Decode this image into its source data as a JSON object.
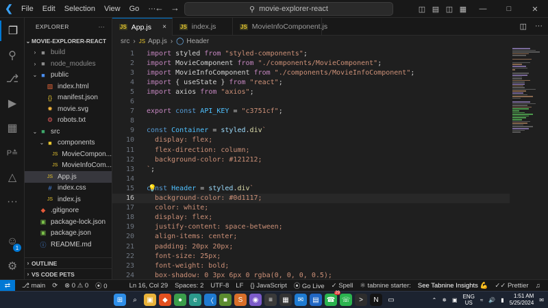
{
  "titlebar": {
    "menu": [
      "File",
      "Edit",
      "Selection",
      "View",
      "Go",
      "···"
    ],
    "search": "movie-explorer-react"
  },
  "activity": {
    "icons": [
      "explorer-icon",
      "search-icon",
      "source-control-icon",
      "run-debug-icon",
      "extensions-icon",
      "testing-icon",
      "remote-explorer-icon",
      "more-icon",
      "accounts-icon",
      "settings-icon"
    ],
    "accounts_badge": "1"
  },
  "sidebar": {
    "header": "EXPLORER",
    "header_more": "···",
    "root": "MOVIE-EXPLORER-REACT",
    "tree": [
      {
        "label": "build",
        "depth": 1,
        "type": "folder",
        "open": false,
        "dim": true
      },
      {
        "label": "node_modules",
        "depth": 1,
        "type": "folder",
        "open": false,
        "dim": true
      },
      {
        "label": "public",
        "depth": 1,
        "type": "folder-public",
        "open": true
      },
      {
        "label": "index.html",
        "depth": 2,
        "type": "html"
      },
      {
        "label": "manifest.json",
        "depth": 2,
        "type": "json"
      },
      {
        "label": "movie.svg",
        "depth": 2,
        "type": "svg"
      },
      {
        "label": "robots.txt",
        "depth": 2,
        "type": "txt"
      },
      {
        "label": "src",
        "depth": 1,
        "type": "folder-src",
        "open": true
      },
      {
        "label": "components",
        "depth": 2,
        "type": "folder-comp",
        "open": true
      },
      {
        "label": "MovieCompon...",
        "depth": 3,
        "type": "js"
      },
      {
        "label": "MovieInfoCom...",
        "depth": 3,
        "type": "js"
      },
      {
        "label": "App.js",
        "depth": 2,
        "type": "js",
        "selected": true
      },
      {
        "label": "index.css",
        "depth": 2,
        "type": "css"
      },
      {
        "label": "index.js",
        "depth": 2,
        "type": "js"
      },
      {
        "label": ".gitignore",
        "depth": 1,
        "type": "git"
      },
      {
        "label": "package-lock.json",
        "depth": 1,
        "type": "npm"
      },
      {
        "label": "package.json",
        "depth": 1,
        "type": "npm"
      },
      {
        "label": "README.md",
        "depth": 1,
        "type": "info"
      }
    ],
    "outline": "OUTLINE",
    "pets": "VS CODE PETS"
  },
  "tabs": [
    {
      "label": "App.js",
      "active": true,
      "close": "×"
    },
    {
      "label": "index.js",
      "active": false
    },
    {
      "label": "MovieInfoComponent.js",
      "active": false
    }
  ],
  "breadcrumb": {
    "folder": "src",
    "file": "App.js",
    "symbol": "Header"
  },
  "editor": {
    "current_line": 16,
    "lines": [
      [
        [
          "kw2",
          "import"
        ],
        [
          "txt",
          " styled "
        ],
        [
          "kw2",
          "from"
        ],
        [
          "txt",
          " "
        ],
        [
          "str",
          "\"styled-components\""
        ],
        [
          "txt",
          ";"
        ]
      ],
      [
        [
          "kw2",
          "import"
        ],
        [
          "txt",
          " MovieComponent "
        ],
        [
          "kw2",
          "from"
        ],
        [
          "txt",
          " "
        ],
        [
          "str",
          "\"./components/MovieComponent\""
        ],
        [
          "txt",
          ";"
        ]
      ],
      [
        [
          "kw2",
          "import"
        ],
        [
          "txt",
          " MovieInfoComponent "
        ],
        [
          "kw2",
          "from"
        ],
        [
          "txt",
          " "
        ],
        [
          "str",
          "\"./components/MovieInfoComponent\""
        ],
        [
          "txt",
          ";"
        ]
      ],
      [
        [
          "kw2",
          "import"
        ],
        [
          "txt",
          " { useState } "
        ],
        [
          "kw2",
          "from"
        ],
        [
          "txt",
          " "
        ],
        [
          "str",
          "\"react\""
        ],
        [
          "txt",
          ";"
        ]
      ],
      [
        [
          "kw2",
          "import"
        ],
        [
          "txt",
          " axios "
        ],
        [
          "kw2",
          "from"
        ],
        [
          "txt",
          " "
        ],
        [
          "str",
          "\"axios\""
        ],
        [
          "txt",
          ";"
        ]
      ],
      [],
      [
        [
          "kw2",
          "export"
        ],
        [
          "txt",
          " "
        ],
        [
          "kw",
          "const"
        ],
        [
          "txt",
          " "
        ],
        [
          "const",
          "API_KEY"
        ],
        [
          "txt",
          " = "
        ],
        [
          "str",
          "\"c3751cf\""
        ],
        [
          "txt",
          ";"
        ]
      ],
      [],
      [
        [
          "kw",
          "const"
        ],
        [
          "txt",
          " "
        ],
        [
          "const",
          "Container"
        ],
        [
          "txt",
          " = "
        ],
        [
          "var",
          "styled"
        ],
        [
          "txt",
          "."
        ],
        [
          "fn",
          "div"
        ],
        [
          "str",
          "`"
        ]
      ],
      [
        [
          "str",
          "  display: flex;"
        ]
      ],
      [
        [
          "str",
          "  flex-direction: column;"
        ]
      ],
      [
        [
          "str",
          "  background-color: #121212;"
        ]
      ],
      [
        [
          "str",
          "`"
        ],
        [
          "txt",
          ";"
        ]
      ],
      [],
      [
        [
          "kw",
          "const"
        ],
        [
          "txt",
          " "
        ],
        [
          "const",
          "Header"
        ],
        [
          "txt",
          " = "
        ],
        [
          "var",
          "styled"
        ],
        [
          "txt",
          "."
        ],
        [
          "fn",
          "div"
        ],
        [
          "str",
          "`"
        ]
      ],
      [
        [
          "str",
          "  background-color: #0d1117;"
        ]
      ],
      [
        [
          "str",
          "  color: white;"
        ]
      ],
      [
        [
          "str",
          "  display: flex;"
        ]
      ],
      [
        [
          "str",
          "  justify-content: space-between;"
        ]
      ],
      [
        [
          "str",
          "  align-items: center;"
        ]
      ],
      [
        [
          "str",
          "  padding: 20px 20px;"
        ]
      ],
      [
        [
          "str",
          "  font-size: 25px;"
        ]
      ],
      [
        [
          "str",
          "  font-weight: bold;"
        ]
      ],
      [
        [
          "str",
          "  box-shadow: 0 3px 6px 0 rgba(0, 0, 0, 0.5);"
        ]
      ]
    ]
  },
  "status": {
    "branch": "main",
    "sync": "⟳",
    "errors": "0",
    "warnings": "0",
    "ports": "0",
    "position": "Ln 16, Col 29",
    "spaces": "Spaces: 2",
    "encoding": "UTF-8",
    "eol": "LF",
    "language": "JavaScript",
    "golive": "Go Live",
    "spell": "Spell",
    "tabnine": "tabnine starter:",
    "tabnine_link": "See Tabnine Insights 💪",
    "prettier": "Prettier"
  },
  "taskbar": {
    "lang_top": "ENG",
    "lang_bottom": "US",
    "time": "1:51 AM",
    "date": "5/25/2024",
    "whatsapp_badge": "29",
    "icons": [
      {
        "name": "windows-start-icon",
        "color": "#2e8ee8",
        "glyph": "⊞"
      },
      {
        "name": "search-icon",
        "color": "transparent",
        "glyph": "⌕"
      },
      {
        "name": "file-explorer-icon",
        "color": "#e8b23a",
        "glyph": "▣"
      },
      {
        "name": "brave-icon",
        "color": "#e3501f",
        "glyph": "◆"
      },
      {
        "name": "chrome-icon",
        "color": "#3b9d4b",
        "glyph": "●"
      },
      {
        "name": "edge-icon",
        "color": "#2b9a8c",
        "glyph": "e"
      },
      {
        "name": "vscode-icon",
        "color": "#1f7ad1",
        "glyph": "〈"
      },
      {
        "name": "terminal-icon",
        "color": "#5b8c2f",
        "glyph": "■"
      },
      {
        "name": "sublime-icon",
        "color": "#d86f2a",
        "glyph": "S"
      },
      {
        "name": "github-icon",
        "color": "#7b5bc9",
        "glyph": "◉"
      },
      {
        "name": "notes-icon",
        "color": "#3a3a3a",
        "glyph": "≡"
      },
      {
        "name": "calculator-icon",
        "color": "#333333",
        "glyph": "▦"
      },
      {
        "name": "mail-icon",
        "color": "#1e7bd2",
        "glyph": "✉"
      },
      {
        "name": "store-icon",
        "color": "#2167c4",
        "glyph": "▤"
      },
      {
        "name": "whatsapp-icon",
        "color": "#2bb34f",
        "glyph": "☎"
      },
      {
        "name": "whatsapp-alt-icon",
        "color": "#2bb34f",
        "glyph": "☏"
      },
      {
        "name": "terminal-alt-icon",
        "color": "#2d2d2d",
        "glyph": ">"
      },
      {
        "name": "netflix-icon",
        "color": "#141414",
        "glyph": "N"
      },
      {
        "name": "cast-icon",
        "color": "transparent",
        "glyph": "▭"
      }
    ]
  },
  "colors": {
    "accent": "#0078d4",
    "background": "#1f1f1f",
    "sidebar": "#181818"
  }
}
